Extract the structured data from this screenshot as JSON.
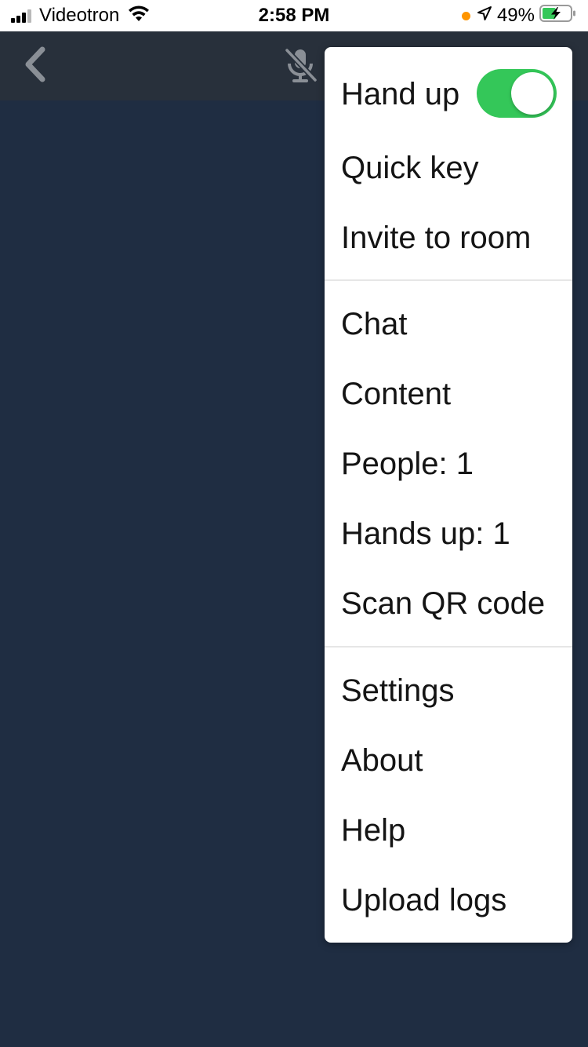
{
  "status_bar": {
    "carrier": "Videotron",
    "time": "2:58 PM",
    "battery_percent": "49%",
    "battery_level": 0.49,
    "icons": [
      "signal-icon",
      "wifi-icon",
      "location-arrow-icon",
      "battery-charging-icon"
    ],
    "recording_dot_color": "#ff9500"
  },
  "top_bar": {
    "icons": [
      "back-chevron-icon",
      "mic-muted-icon"
    ]
  },
  "menu": {
    "hand_up": {
      "label": "Hand up",
      "toggle_on": true,
      "toggle_color": "#34c759"
    },
    "quick_key": "Quick key",
    "invite_to_room": "Invite to room",
    "chat": "Chat",
    "content": "Content",
    "people": "People: 1",
    "hands_up": "Hands up: 1",
    "scan_qr_code": "Scan QR code",
    "settings": "Settings",
    "about": "About",
    "help": "Help",
    "upload_logs": "Upload logs"
  },
  "colors": {
    "background": "#1f2d42",
    "top_bar": "#28303b",
    "menu_bg": "#ffffff",
    "icon_gray": "#8a8f96"
  }
}
